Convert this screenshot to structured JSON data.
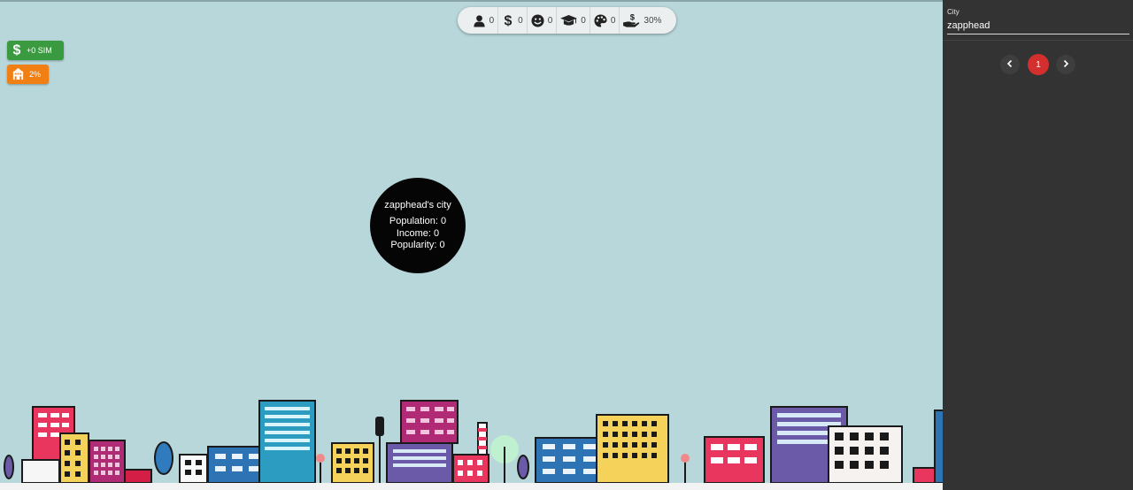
{
  "stats": [
    {
      "icon": "person-icon",
      "value": "0"
    },
    {
      "icon": "dollar-icon",
      "value": "0"
    },
    {
      "icon": "smiley-icon",
      "value": "0"
    },
    {
      "icon": "graduation-cap-icon",
      "value": "0"
    },
    {
      "icon": "palette-icon",
      "value": "0"
    },
    {
      "icon": "hand-dollar-icon",
      "value": "30%"
    }
  ],
  "badges": {
    "sim": {
      "icon": "dollar-icon",
      "label": "+0 SIM",
      "color": "#3a9a3f"
    },
    "discount": {
      "icon": "building-icon",
      "label": "2%",
      "color": "#f07f14"
    }
  },
  "city": {
    "name": "zapphead's city",
    "population": "Population: 0",
    "income": "Income: 0",
    "popularity": "Popularity: 0"
  },
  "panel": {
    "city_label": "City",
    "city_value": "zapphead",
    "pagination": {
      "current": "1"
    }
  },
  "colors": {
    "sky": "#b8d7da",
    "panel": "#333333",
    "active_page": "#d32f2f"
  }
}
